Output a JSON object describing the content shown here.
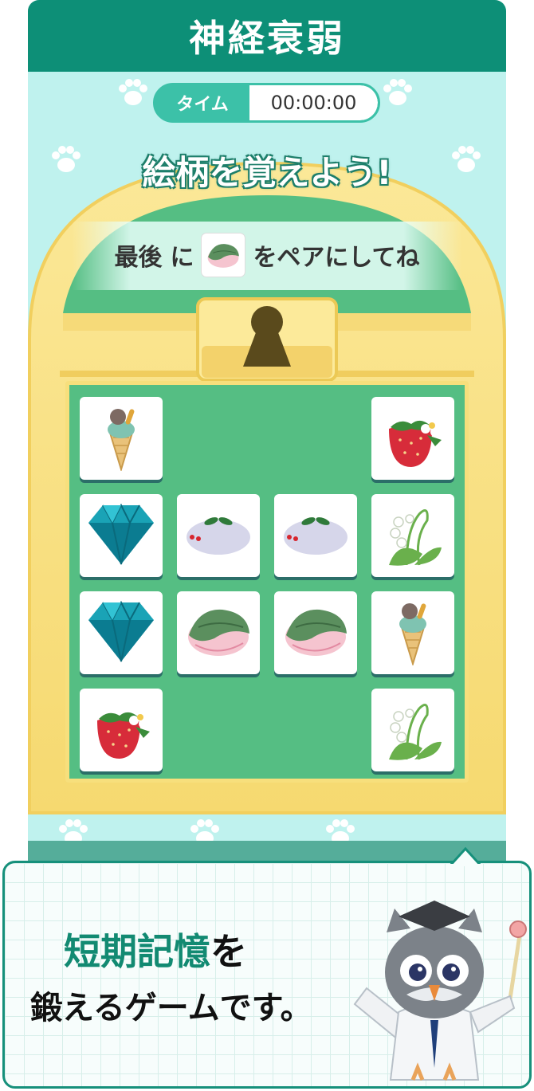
{
  "game": {
    "title": "神経衰弱",
    "timer": {
      "label": "タイム",
      "value": "00:00:00"
    },
    "headline": "絵柄を覚えよう!",
    "instruction": {
      "prefix": "最後",
      "mid": "に",
      "suffix": "をペアにしてね",
      "target_icon": "sakura-mochi-icon"
    },
    "cards": [
      {
        "icon": "ice-cream-icon"
      },
      {
        "icon": "empty"
      },
      {
        "icon": "empty"
      },
      {
        "icon": "strawberry-icon"
      },
      {
        "icon": "diamond-icon"
      },
      {
        "icon": "snow-bunny-icon"
      },
      {
        "icon": "snow-bunny-icon"
      },
      {
        "icon": "lily-of-the-valley-icon"
      },
      {
        "icon": "diamond-icon"
      },
      {
        "icon": "sakura-mochi-icon"
      },
      {
        "icon": "sakura-mochi-icon"
      },
      {
        "icon": "ice-cream-icon"
      },
      {
        "icon": "strawberry-icon"
      },
      {
        "icon": "empty"
      },
      {
        "icon": "empty"
      },
      {
        "icon": "lily-of-the-valley-icon"
      }
    ]
  },
  "caption": {
    "highlight": "短期記憶",
    "rest": "を",
    "line2": "鍛えるゲームです。"
  },
  "colors": {
    "header": "#0d8f77",
    "accent": "#3cc1a8",
    "board": "#55be83",
    "chest": "#f7df7c"
  }
}
